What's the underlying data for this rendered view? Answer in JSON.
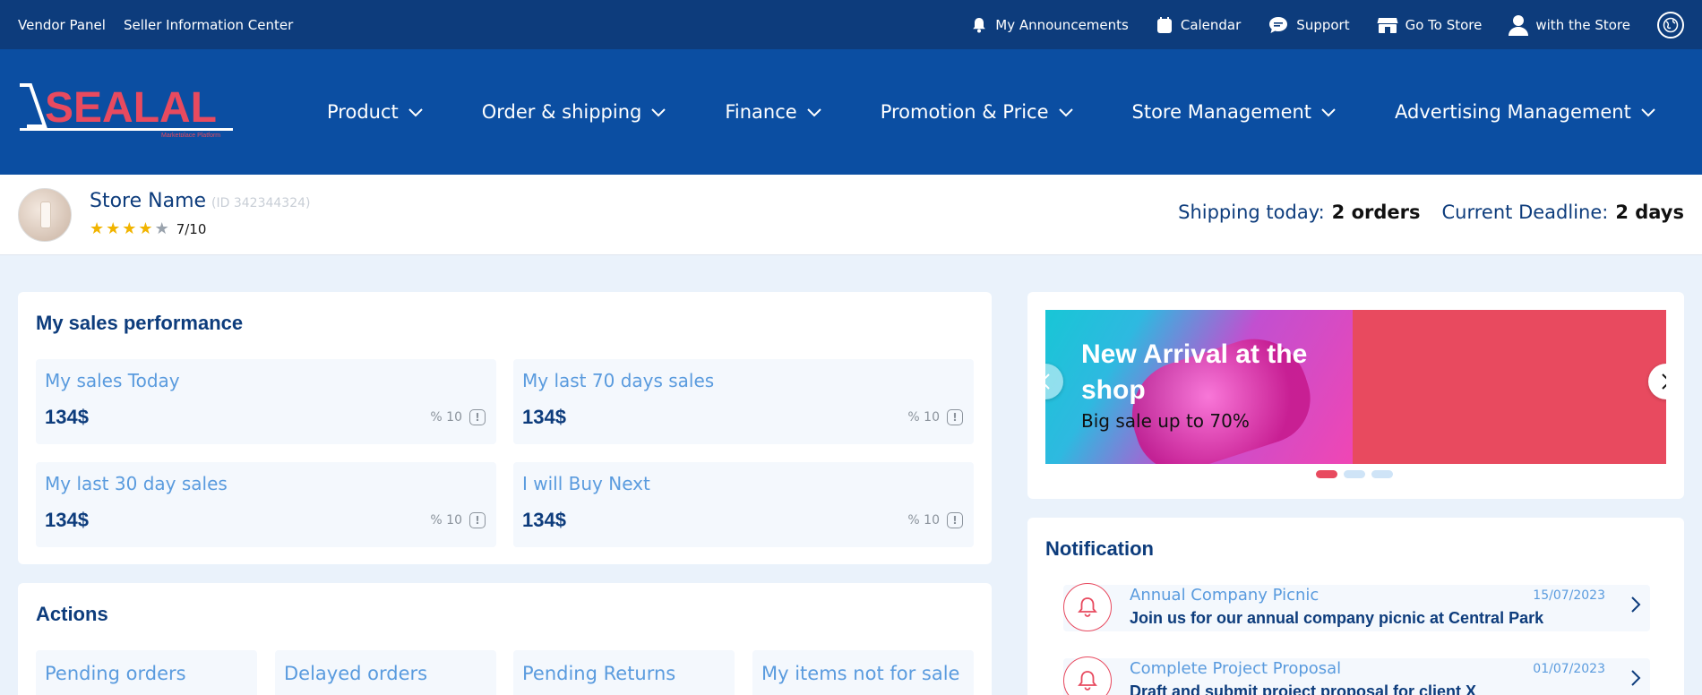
{
  "topbar": {
    "left": [
      "Vendor Panel",
      "Seller Information Center"
    ],
    "links": [
      {
        "icon": "bell-icon",
        "label": "My Announcements"
      },
      {
        "icon": "calendar-icon",
        "label": "Calendar"
      },
      {
        "icon": "chat-icon",
        "label": "Support"
      },
      {
        "icon": "store-icon",
        "label": "Go To Store"
      },
      {
        "icon": "user-icon",
        "label": "with the Store"
      }
    ]
  },
  "logo": {
    "text": "SEALAL",
    "tagline": "Marketplace Platform"
  },
  "nav": [
    "Product",
    "Order & shipping",
    "Finance",
    "Promotion & Price",
    "Store Management",
    "Advertising Management"
  ],
  "store": {
    "name": "Store Name",
    "id": "(ID 342344324)",
    "rating": "7/10",
    "stars_filled": 4,
    "stars_total": 5,
    "shipping_label": "Shipping today:",
    "shipping_value": "2 orders",
    "deadline_label": "Current Deadline:",
    "deadline_value": "2 days"
  },
  "sales": {
    "title": "My sales performance",
    "items": [
      {
        "label": "My sales Today",
        "value": "134$",
        "pct": "% 10"
      },
      {
        "label": "My last 70 days sales",
        "value": "134$",
        "pct": "% 10"
      },
      {
        "label": "My last 30 day sales",
        "value": "134$",
        "pct": "% 10"
      },
      {
        "label": "I will Buy Next",
        "value": "134$",
        "pct": "% 10"
      }
    ]
  },
  "actions": {
    "title": "Actions",
    "items": [
      "Pending orders",
      "Delayed orders",
      "Pending Returns",
      "My items not for sale"
    ]
  },
  "banner": {
    "headline": "New Arrival at the shop",
    "sub": "Big sale up to 70%",
    "slides": 3,
    "active_slide": 1
  },
  "notifications": {
    "title": "Notification",
    "items": [
      {
        "title": "Annual Company Picnic",
        "date": "15/07/2023",
        "body": "Join us for our annual company picnic at Central Park"
      },
      {
        "title": "Complete Project Proposal",
        "date": "01/07/2023",
        "body": "Draft and submit project proposal for client X"
      }
    ]
  },
  "colors": {
    "primary": "#0b4ea2",
    "topbar": "#0d3c7c",
    "accent": "#e84a5f",
    "light_blue": "#5a9bde",
    "star": "#f1b400"
  }
}
